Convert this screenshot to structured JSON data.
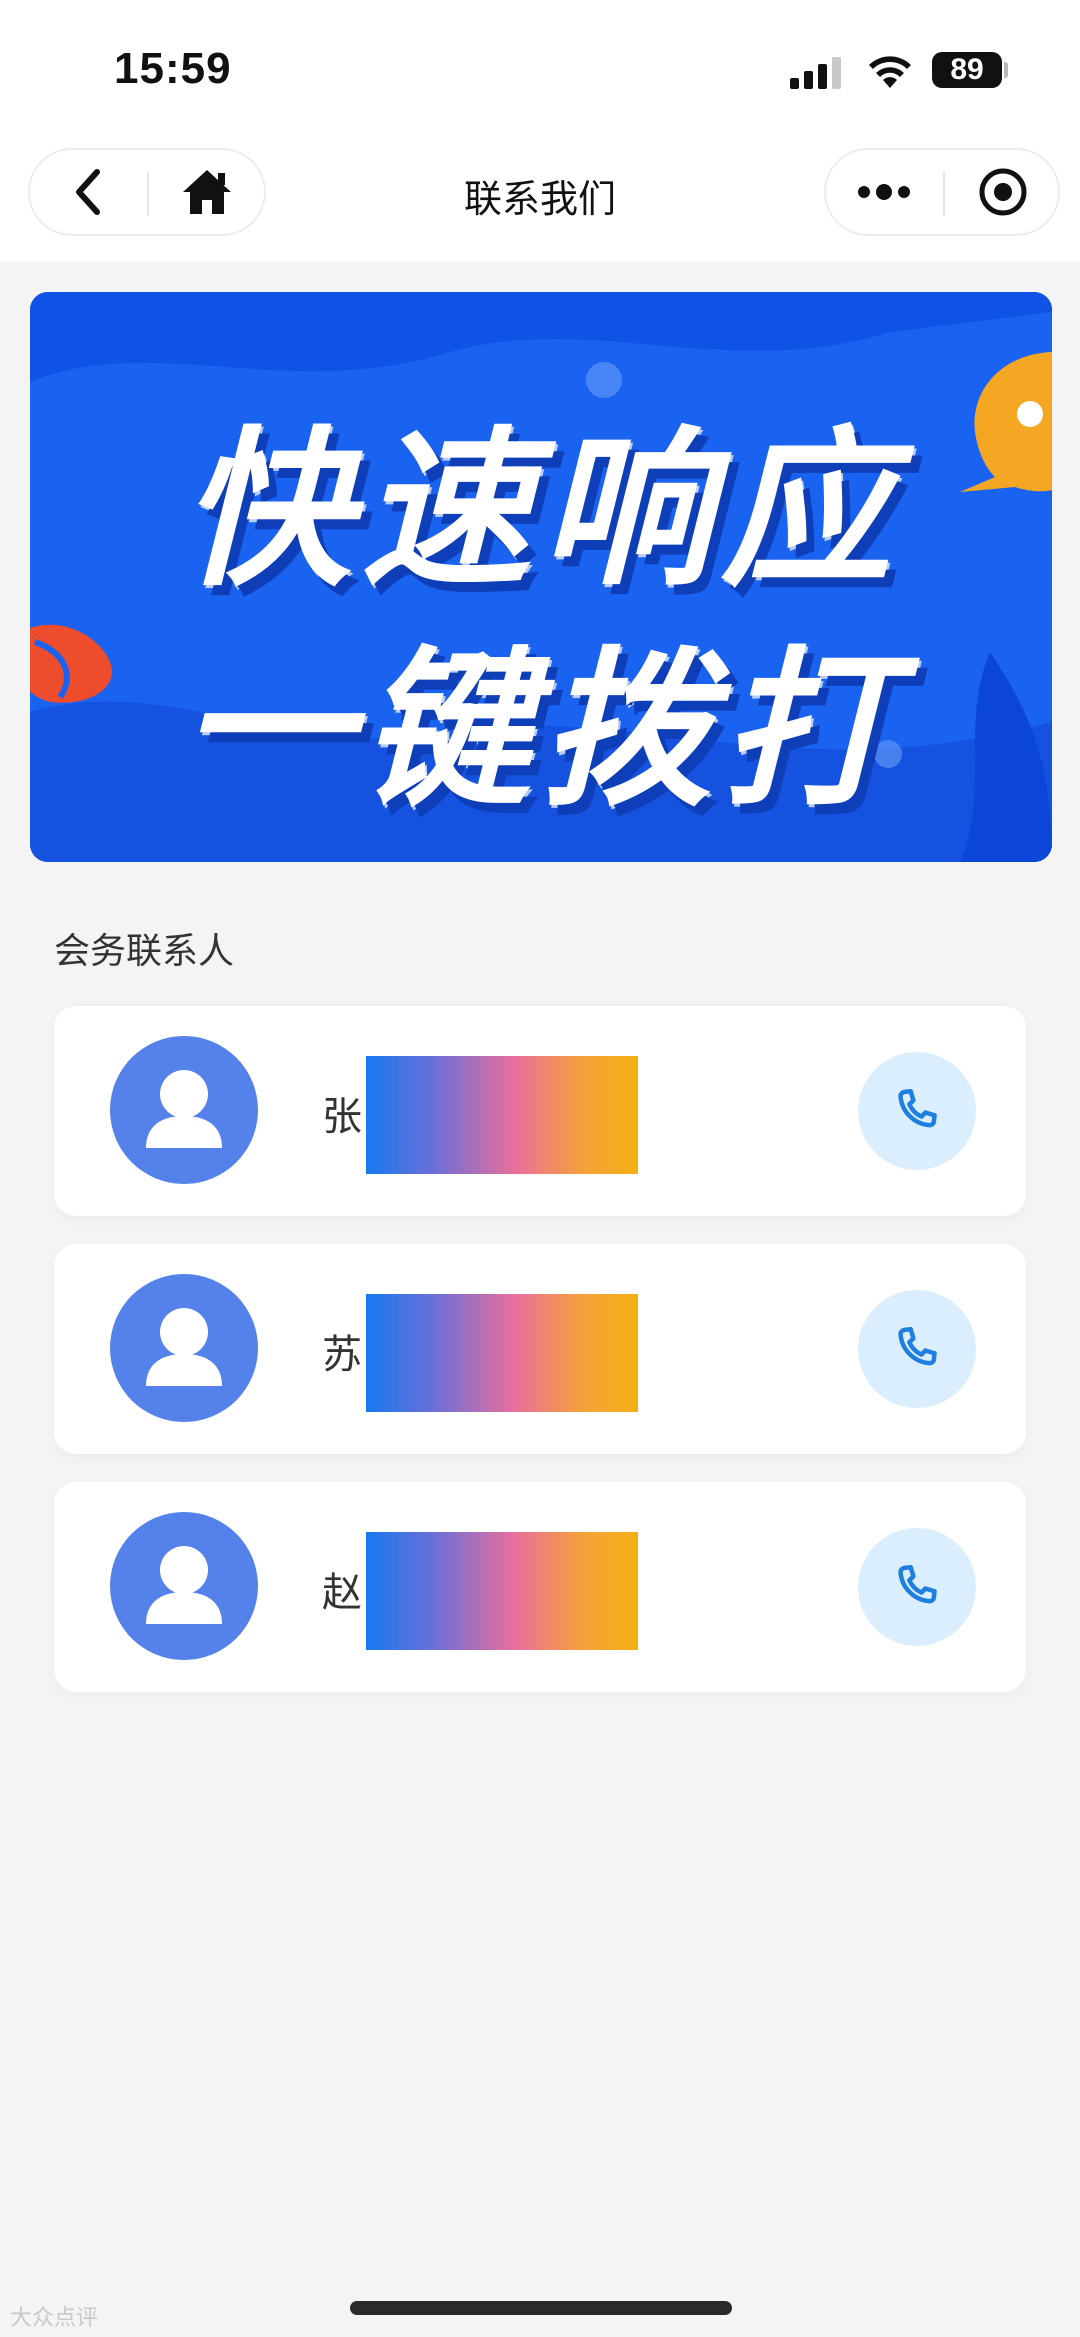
{
  "status_bar": {
    "time": "15:59",
    "battery": "89",
    "icons": [
      "cellular-signal-icon",
      "wifi-icon",
      "battery-icon"
    ]
  },
  "nav": {
    "title": "联系我们",
    "icons": [
      "back-icon",
      "home-icon",
      "more-icon",
      "record-icon"
    ]
  },
  "banner": {
    "line1": "快速响应",
    "line2": "一键拨打",
    "colors": {
      "background": "#1a62f0",
      "accent_orange": "#f5a623",
      "accent_red": "#ee4d2d"
    }
  },
  "section": {
    "title": "会务联系人"
  },
  "contacts": [
    {
      "surname": "张",
      "name_redacted": true,
      "icon": "phone-icon"
    },
    {
      "surname": "苏",
      "name_redacted": true,
      "icon": "phone-icon"
    },
    {
      "surname": "赵",
      "name_redacted": true,
      "icon": "phone-icon"
    }
  ],
  "colors": {
    "page_bg": "#f4f4f5",
    "avatar": "#5582ea",
    "call_button_bg": "#dbeefd",
    "call_icon": "#1e7fe0"
  },
  "watermark": "大众点评"
}
